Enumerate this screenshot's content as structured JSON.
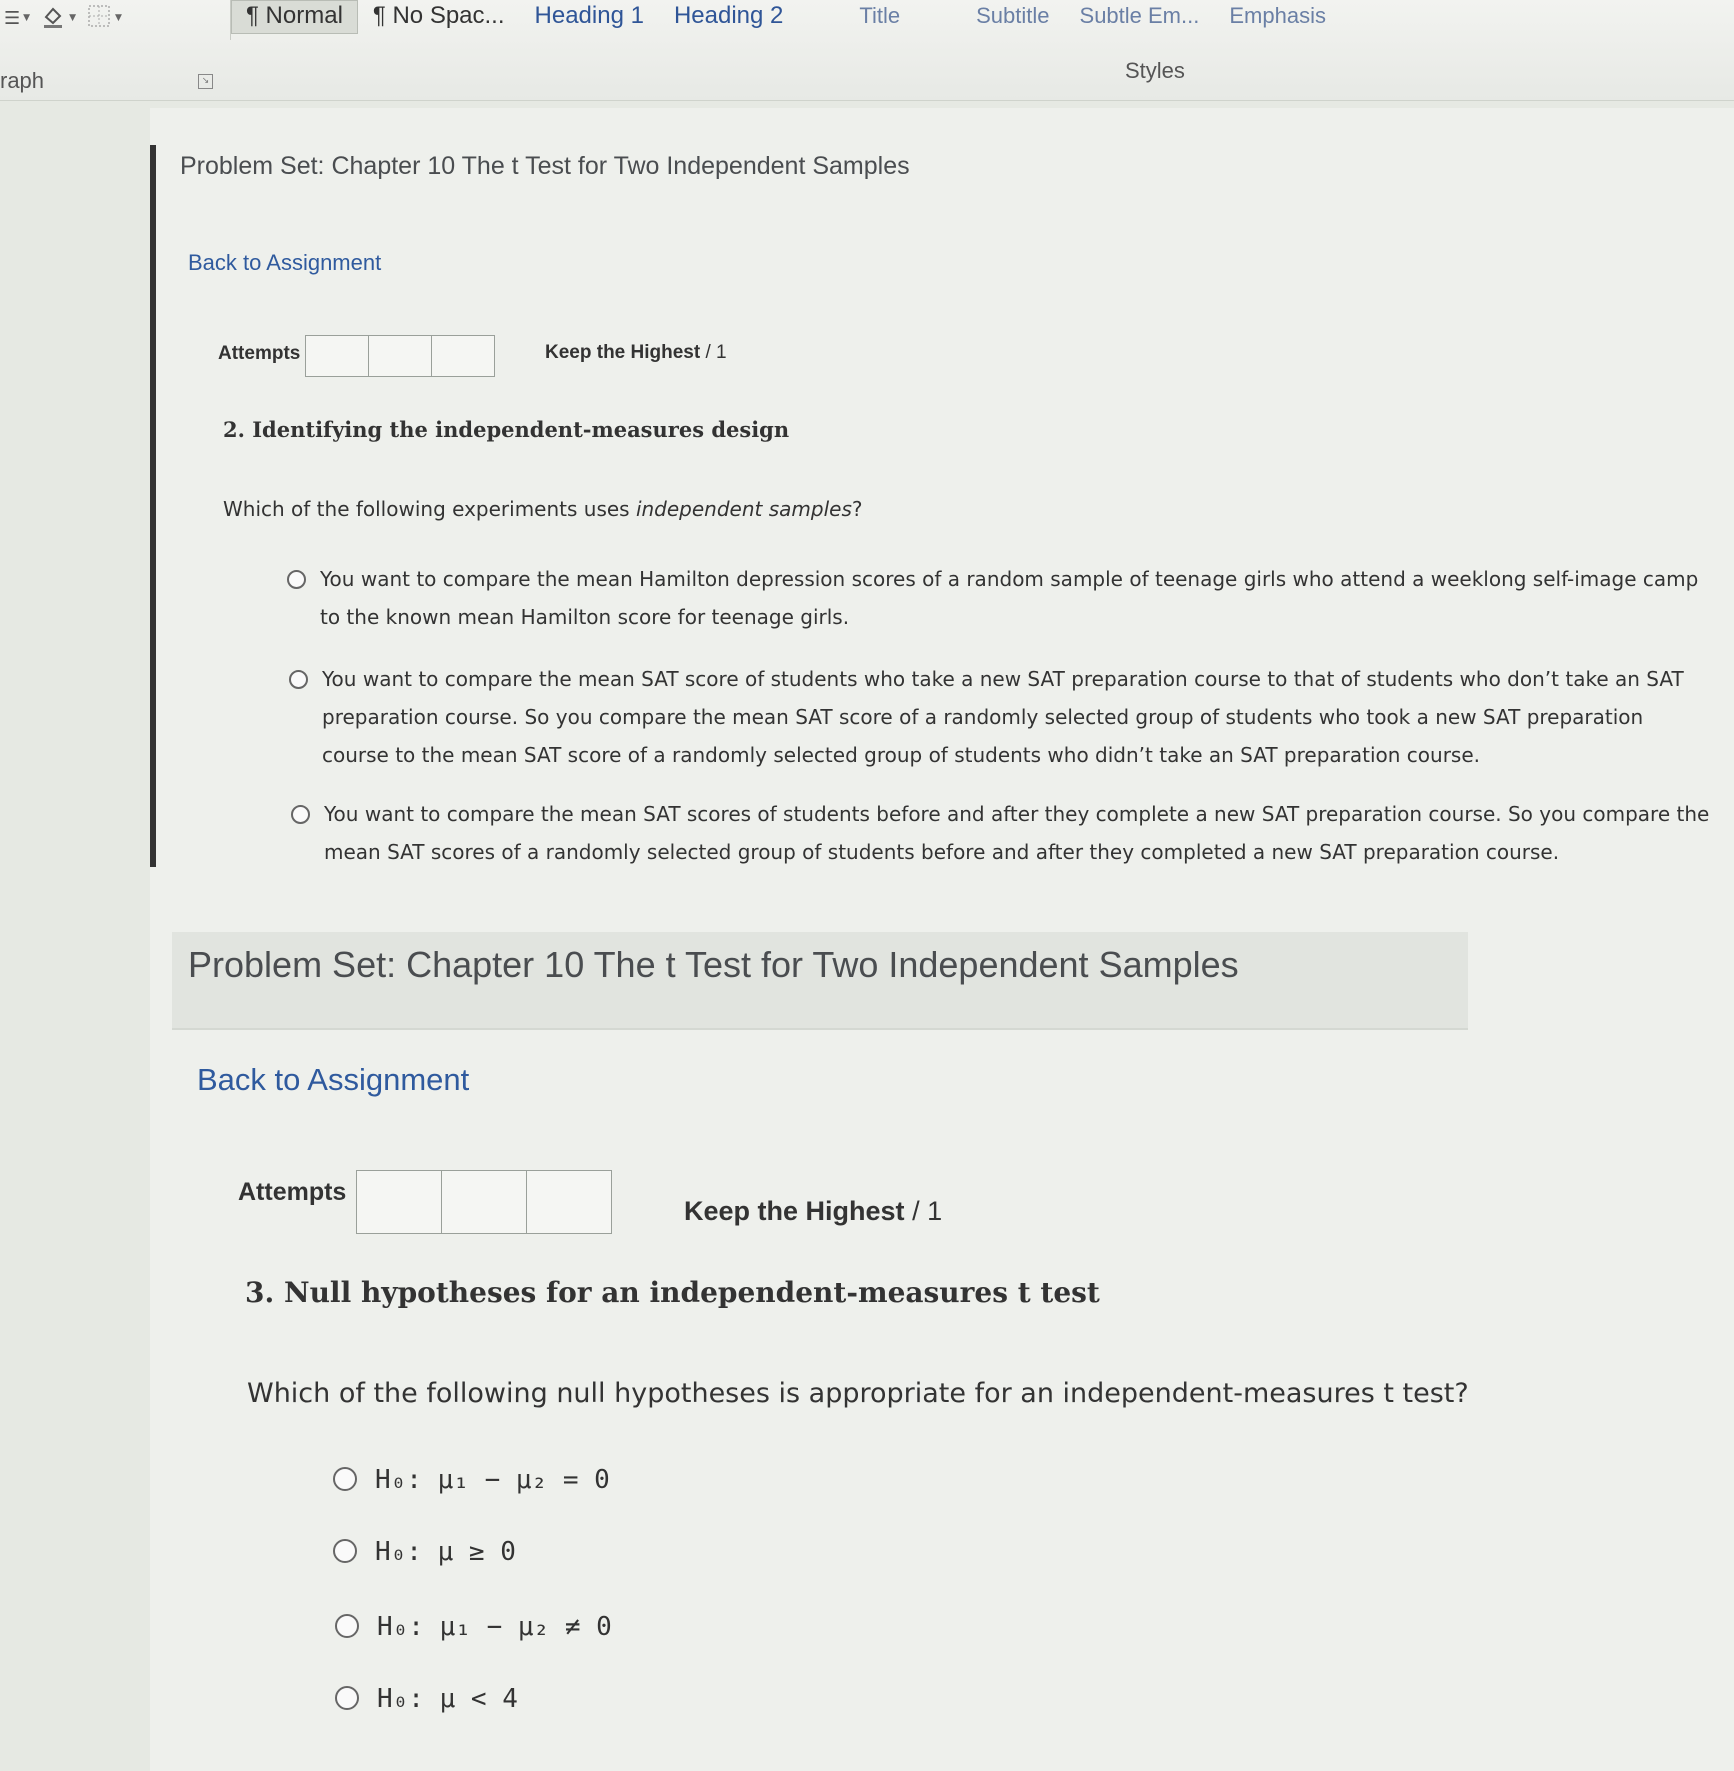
{
  "ribbon": {
    "paragraph_group_label": "raph",
    "styles_group_label": "Styles",
    "style_tiles": [
      "¶ Normal",
      "¶ No Spac...",
      "Heading 1",
      "Heading 2",
      "Title",
      "Subtitle",
      "Subtle Em...",
      "Emphasis"
    ],
    "icons": [
      "list-icon",
      "shading-icon",
      "borders-icon",
      "dialog-launcher-icon"
    ]
  },
  "section1": {
    "header": "Problem Set: Chapter 10 The t Test for Two Independent Samples",
    "back_link": "Back to Assignment",
    "attempts_label": "Attempts",
    "attempt_boxes": 3,
    "keep_label": "Keep the Highest",
    "keep_score": "/ 1",
    "question_title": "2. Identifying the independent-measures design",
    "prompt_before": "Which of the following experiments uses ",
    "prompt_italic": "independent samples",
    "prompt_after": "?",
    "options": [
      "You want to compare the mean Hamilton depression scores of a random sample of teenage girls who attend a weeklong self-image camp to the known mean Hamilton score for teenage girls.",
      "You want to compare the mean SAT score of students who take a new SAT preparation course to that of students who don’t take an SAT preparation course. So you compare the mean SAT score of a randomly selected group of students who took a new SAT preparation course to the mean SAT score of a randomly selected group of students who didn’t take an SAT preparation course.",
      "You want to compare the mean SAT scores of students before and after they complete a new SAT preparation course. So you compare the mean SAT scores of a randomly selected group of students before and after they completed a new SAT preparation course."
    ]
  },
  "section2": {
    "header": "Problem Set: Chapter 10 The t Test for Two Independent Samples",
    "back_link": "Back to Assignment",
    "attempts_label": "Attempts",
    "attempt_boxes": 3,
    "keep_label": "Keep the Highest",
    "keep_score": "/ 1",
    "question_title": "3. Null hypotheses for an independent-measures t test",
    "prompt": "Which of the following null hypotheses is appropriate for an independent-measures t test?",
    "options": [
      "H₀: μ₁ − μ₂ = 0",
      "H₀: μ ≥ 0",
      "H₀: μ₁ − μ₂ ≠ 0",
      "H₀: μ < 4"
    ]
  }
}
